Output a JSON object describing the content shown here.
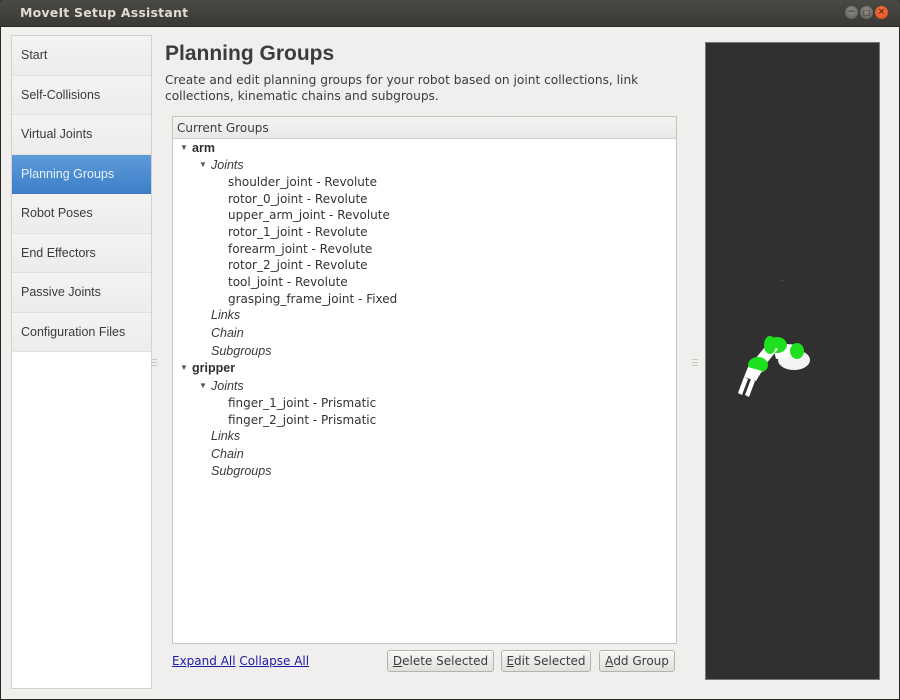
{
  "window": {
    "title": "MoveIt Setup Assistant",
    "controls": {
      "minimize": "−",
      "maximize": "□",
      "close": "×"
    }
  },
  "sidebar": {
    "items": [
      {
        "label": "Start",
        "active": false
      },
      {
        "label": "Self-Collisions",
        "active": false
      },
      {
        "label": "Virtual Joints",
        "active": false
      },
      {
        "label": "Planning Groups",
        "active": true
      },
      {
        "label": "Robot Poses",
        "active": false
      },
      {
        "label": "End Effectors",
        "active": false
      },
      {
        "label": "Passive Joints",
        "active": false
      },
      {
        "label": "Configuration Files",
        "active": false
      }
    ]
  },
  "main": {
    "title": "Planning Groups",
    "description": "Create and edit planning groups for your robot based on joint collections, link collections, kinematic chains and subgroups.",
    "tree": {
      "header": "Current Groups",
      "groups": [
        {
          "name": "arm",
          "joints_label": "Joints",
          "joints": [
            "shoulder_joint - Revolute",
            "rotor_0_joint - Revolute",
            "upper_arm_joint - Revolute",
            "rotor_1_joint - Revolute",
            "forearm_joint - Revolute",
            "rotor_2_joint - Revolute",
            "tool_joint - Revolute",
            "grasping_frame_joint - Fixed"
          ],
          "links_label": "Links",
          "chain_label": "Chain",
          "subgroups_label": "Subgroups"
        },
        {
          "name": "gripper",
          "joints_label": "Joints",
          "joints": [
            "finger_1_joint - Prismatic",
            "finger_2_joint - Prismatic"
          ],
          "links_label": "Links",
          "chain_label": "Chain",
          "subgroups_label": "Subgroups"
        }
      ],
      "expand_arrow": "▼"
    },
    "links": {
      "expand_all": "Expand All",
      "collapse_all": "Collapse All"
    },
    "buttons": {
      "delete": {
        "mnemonic": "D",
        "rest": "elete Selected"
      },
      "edit": {
        "mnemonic": "E",
        "rest": "dit Selected"
      },
      "add": {
        "mnemonic": "A",
        "rest": "dd Group"
      }
    }
  },
  "viewport": {
    "content": "robot-arm-3d-preview",
    "colors": {
      "background": "#303030",
      "joint": "#1ee01e",
      "link": "#ffffff"
    }
  },
  "colors": {
    "accent": "#4a8bd0",
    "link": "#1a1aa6",
    "close_button": "#e9571f"
  }
}
